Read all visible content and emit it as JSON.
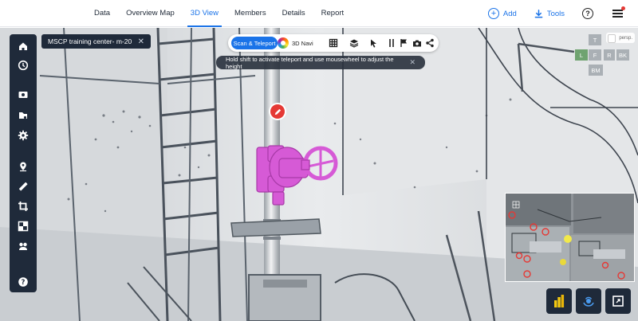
{
  "nav": {
    "tabs": [
      {
        "label": "Data"
      },
      {
        "label": "Overview Map"
      },
      {
        "label": "3D View"
      },
      {
        "label": "Members"
      },
      {
        "label": "Details"
      },
      {
        "label": "Report"
      }
    ],
    "active_tab": "3D View",
    "add_label": "Add",
    "tools_label": "Tools",
    "help_glyph": "?"
  },
  "project": {
    "name": "MSCP training center- m-20",
    "close_glyph": "✕"
  },
  "center_toolbar": {
    "mode_active": "Scan & Teleport",
    "mode_alt": "3D Navi",
    "icons": [
      "grid-icon",
      "layers-icon",
      "cursor-icon",
      "ruler-icon",
      "flag-icon",
      "camera-icon",
      "share-icon"
    ]
  },
  "hint": {
    "text": "Hold shift to activate teleport and use mousewheel to adjust the height",
    "close_glyph": "✕"
  },
  "left_toolbar": {
    "icons": [
      "home-icon",
      "clock-icon",
      "panorama-icon",
      "explore-icon",
      "settings-icon",
      "location-icon",
      "measure-icon",
      "crop-icon",
      "clipping-icon",
      "markup-icon",
      "help-icon"
    ]
  },
  "view_cube": {
    "top": "T",
    "left": "L",
    "front": "F",
    "right": "R",
    "back": "BK",
    "bottom": "BM",
    "projection": "persp."
  },
  "bottom_buttons": [
    "powerbi-icon",
    "scanner-icon",
    "fullscreen-icon"
  ],
  "colors": {
    "accent": "#1a73e8",
    "dark_panel": "#1f2a3a",
    "valve": "#d65ad6",
    "marker": "#e53935"
  }
}
